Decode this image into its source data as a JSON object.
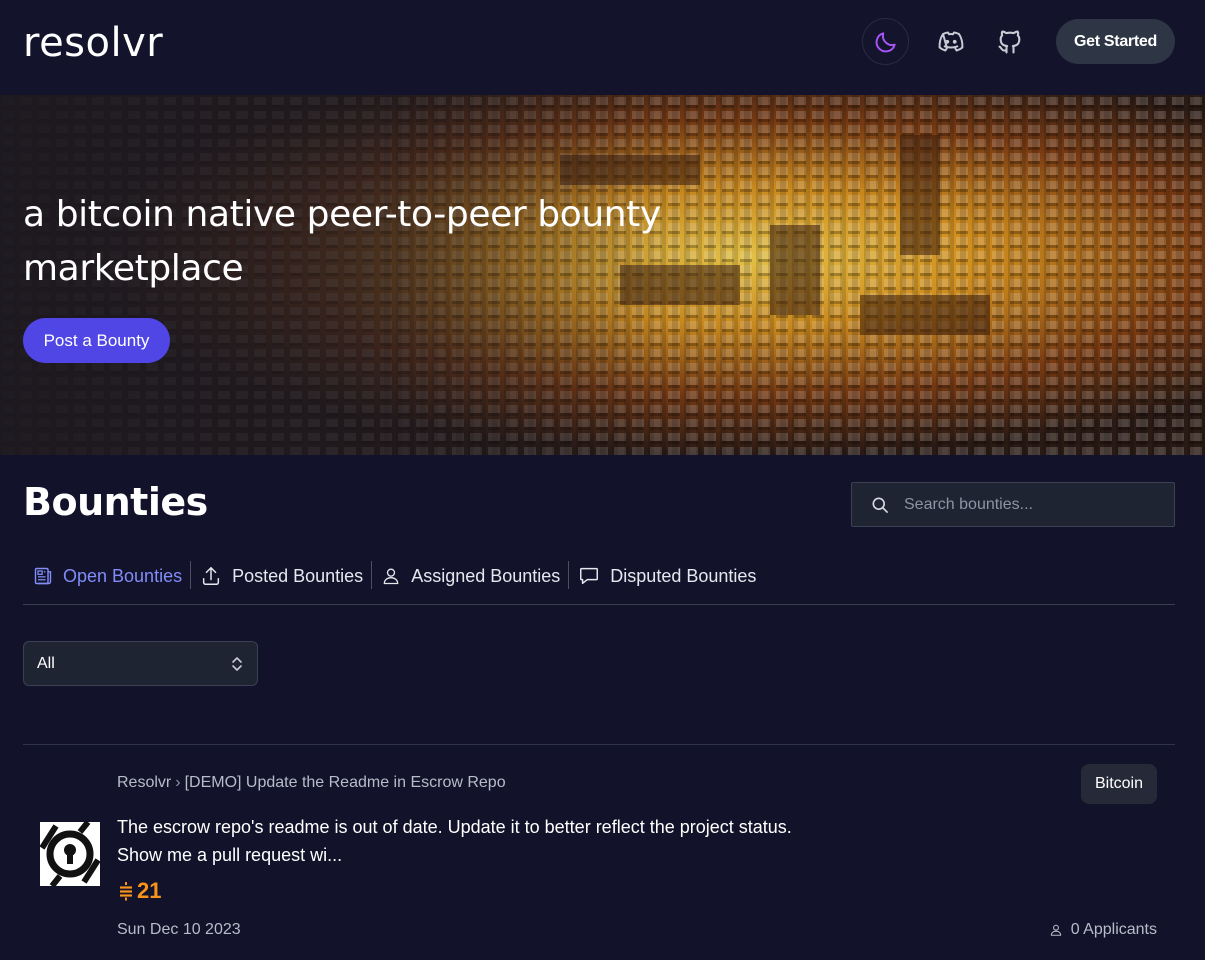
{
  "header": {
    "logo": "resolvr",
    "get_started_label": "Get Started",
    "icons": [
      "moon-icon",
      "discord-icon",
      "github-icon"
    ],
    "moon_color": "#a855f7"
  },
  "hero": {
    "title": "a bitcoin native peer-to-peer bounty marketplace",
    "post_bounty_label": "Post a Bounty",
    "button_color": "#4f46e5"
  },
  "bounties": {
    "title": "Bounties",
    "search_placeholder": "Search bounties...",
    "tabs": [
      {
        "label": "Open Bounties",
        "icon": "document-icon",
        "active": true
      },
      {
        "label": "Posted Bounties",
        "icon": "upload-icon",
        "active": false
      },
      {
        "label": "Assigned Bounties",
        "icon": "user-icon",
        "active": false
      },
      {
        "label": "Disputed Bounties",
        "icon": "chat-icon",
        "active": false
      }
    ],
    "filter": {
      "selected": "All"
    },
    "items": [
      {
        "breadcrumb_project": "Resolvr",
        "breadcrumb_title": "[DEMO] Update the Readme in Escrow Repo",
        "tag": "Bitcoin",
        "description": "The escrow repo's readme is out of date. Update it to better reflect the project status. Show me a pull request wi...",
        "amount": "21",
        "date": "Sun Dec 10 2023",
        "applicants": "0 Applicants"
      }
    ]
  },
  "colors": {
    "accent": "#818cf8",
    "sats": "#f7931a",
    "background": "#12122a"
  }
}
